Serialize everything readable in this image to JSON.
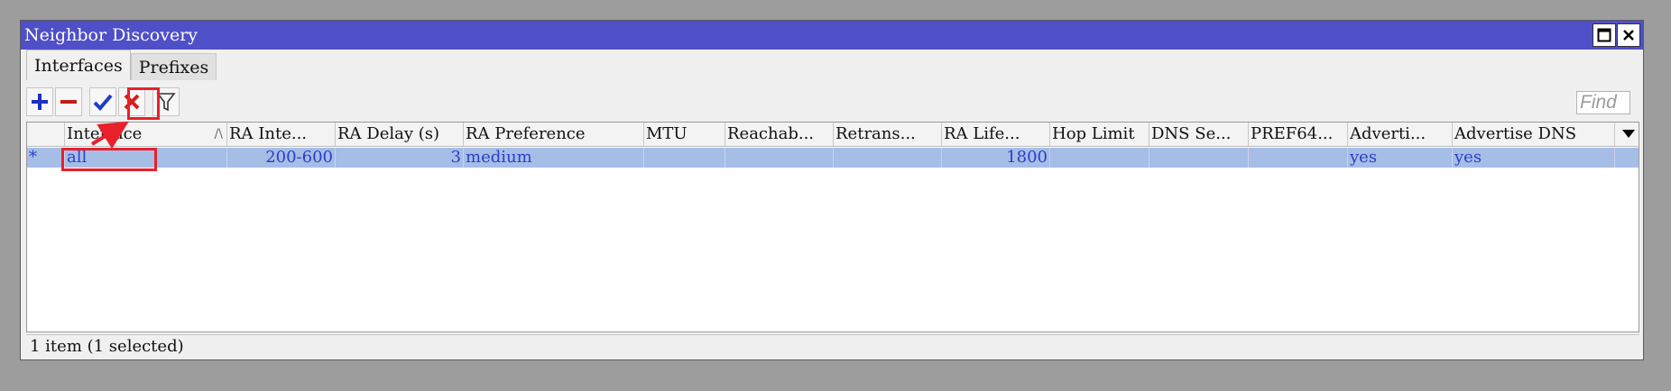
{
  "window": {
    "title": "Neighbor Discovery"
  },
  "tabs": [
    {
      "label": "Interfaces",
      "active": true
    },
    {
      "label": "Prefixes",
      "active": false
    }
  ],
  "toolbar": {
    "buttons": [
      {
        "name": "add",
        "icon": "plus-icon"
      },
      {
        "name": "remove",
        "icon": "minus-icon"
      },
      {
        "name": "enable",
        "icon": "check-icon"
      },
      {
        "name": "disable",
        "icon": "cross-icon"
      },
      {
        "name": "filter",
        "icon": "filter-icon"
      }
    ],
    "find_placeholder": "Find"
  },
  "table": {
    "columns": [
      "",
      "Interface",
      "RA Inte...",
      "RA Delay (s)",
      "RA Preference",
      "MTU",
      "Reachab...",
      "Retrans...",
      "RA Life...",
      "Hop Limit",
      "DNS Se...",
      "PREF64...",
      "Adverti...",
      "Advertise DNS"
    ],
    "sort_indicator": "/\\",
    "rows": [
      {
        "marker": "*",
        "interface": "all",
        "ra_interval": "200-600",
        "ra_delay": "3",
        "ra_preference": "medium",
        "mtu": "",
        "reachable": "",
        "retrans": "",
        "ra_lifetime": "1800",
        "hop_limit": "",
        "dns_servers": "",
        "pref64": "",
        "advertise": "yes",
        "advertise_dns": "yes"
      }
    ]
  },
  "status": {
    "text": "1 item (1 selected)"
  },
  "colors": {
    "titlebar": "#4f4fc7",
    "selected_row": "#a6bde6",
    "annotation": "#e8202a"
  }
}
